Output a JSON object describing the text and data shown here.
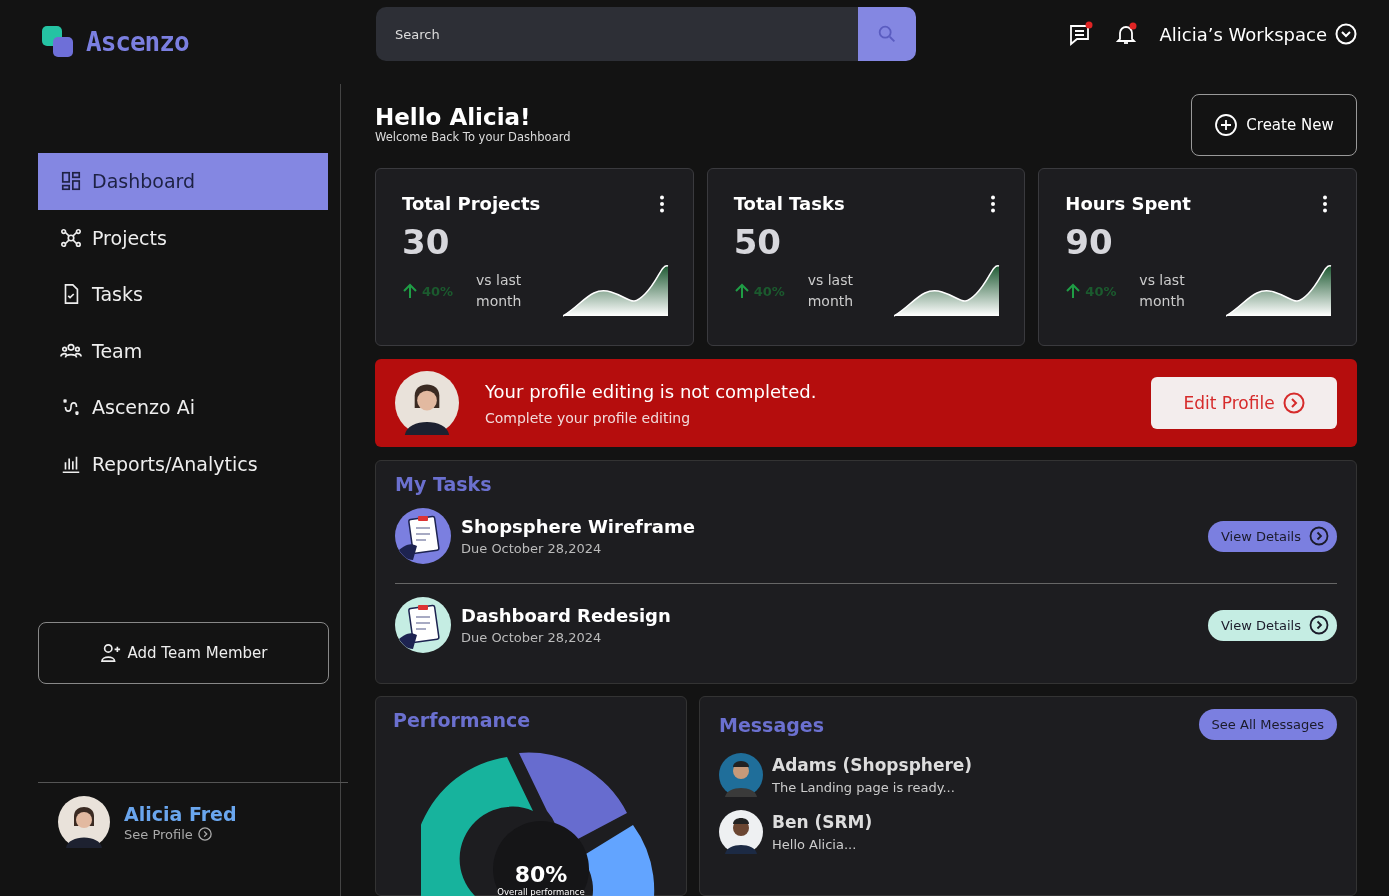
{
  "brand": {
    "name": "Ascenzo"
  },
  "search": {
    "placeholder": "Search"
  },
  "header": {
    "chat_unread": true,
    "bell_unread": true,
    "workspace": "Alicia’s Workspace"
  },
  "nav": [
    {
      "label": "Dashboard",
      "selected": true
    },
    {
      "label": "Projects",
      "selected": false
    },
    {
      "label": "Tasks",
      "selected": false
    },
    {
      "label": "Team",
      "selected": false
    },
    {
      "label": "Ascenzo Ai",
      "selected": false
    },
    {
      "label": "Reports/Analytics",
      "selected": false
    }
  ],
  "add_member": "Add Team Member",
  "profile": {
    "name": "Alicia Fred",
    "link": "See Profile"
  },
  "greeting": {
    "title": "Hello Alicia!",
    "subtitle": "Welcome Back To your Dashboard"
  },
  "create_button": "Create New",
  "stats": [
    {
      "title": "Total Projects",
      "value": "30",
      "change": "40%",
      "note": "vs last month"
    },
    {
      "title": "Total Tasks",
      "value": "50",
      "change": "40%",
      "note": "vs last month"
    },
    {
      "title": "Hours Spent",
      "value": "90",
      "change": "40%",
      "note": "vs last month"
    }
  ],
  "alert": {
    "title": "Your profile editing is not completed.",
    "text": "Complete your profile editing",
    "button": "Edit Profile"
  },
  "tasks": {
    "title": "My Tasks",
    "items": [
      {
        "name": "Shopsphere Wireframe",
        "due": "Due October 28,2024",
        "button": "View Details",
        "color": "#7b7fe0"
      },
      {
        "name": "Dashboard Redesign",
        "due": "Due October 28,2024",
        "button": "View Details",
        "color": "#c5ede3"
      }
    ]
  },
  "performance": {
    "title": "Performance",
    "value": "80%",
    "caption": "Overall performance"
  },
  "messages": {
    "title": "Messages",
    "button": "See All Messages",
    "items": [
      {
        "name": "Adams (Shopsphere)",
        "text": "The Landing page is ready..."
      },
      {
        "name": "Ben (SRM)",
        "text": "Hello Alicia..."
      }
    ]
  }
}
